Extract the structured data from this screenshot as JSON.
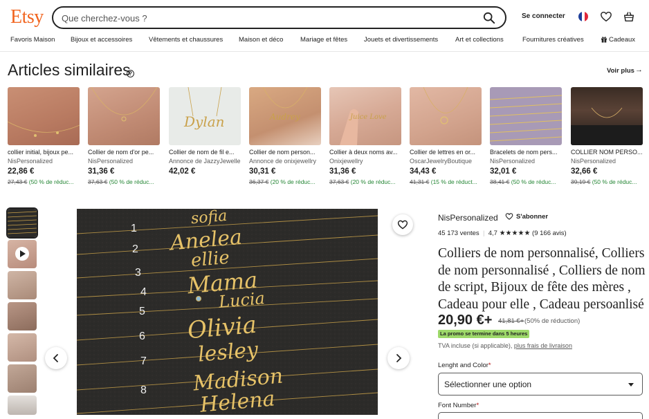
{
  "header": {
    "logo": "Etsy",
    "search_placeholder": "Que cherchez-vous ?",
    "signin": "Se connecter",
    "icons": [
      "search-icon",
      "flag-fr-icon",
      "heart-icon",
      "basket-icon"
    ]
  },
  "categories": [
    "Favoris Maison",
    "Bijoux et accessoires",
    "Vêtements et chaussures",
    "Maison et déco",
    "Mariage et fêtes",
    "Jouets et divertissements",
    "Art et collections",
    "Fournitures créatives",
    "Cadeaux"
  ],
  "similar": {
    "title": "Articles similaires",
    "see_more": "Voir plus",
    "items": [
      {
        "title": "collier initial, bijoux pe...",
        "shop": "NisPersonalized",
        "price": "22,86 €",
        "old": "27,43 €",
        "discount": "(50 % de réduc...",
        "caption": ""
      },
      {
        "title": "Collier de nom d'or pe...",
        "shop": "NisPersonalized",
        "price": "31,36 €",
        "old": "37,63 €",
        "discount": "(50 % de réduc...",
        "caption": ""
      },
      {
        "title": "Collier de nom de fil e...",
        "shop": "Annonce de JazzyJewelle",
        "price": "42,02 €",
        "old": "",
        "discount": "",
        "caption": "Dylan"
      },
      {
        "title": "Collier de nom person...",
        "shop": "Annonce de onixjewellry",
        "price": "30,31 €",
        "old": "36,37 €",
        "discount": "(20 % de réduc...",
        "caption": "Audrey"
      },
      {
        "title": "Collier à deux noms av...",
        "shop": "Onixjewellry",
        "price": "31,36 €",
        "old": "37,63 €",
        "discount": "(20 % de réduc...",
        "caption": "Juice Love"
      },
      {
        "title": "Collier de lettres en or...",
        "shop": "OscarJewelryBoutique",
        "price": "34,43 €",
        "old": "41,31 €",
        "discount": "(15 % de réduct...",
        "caption": ""
      },
      {
        "title": "Bracelets de nom pers...",
        "shop": "NisPersonalized",
        "price": "32,01 €",
        "old": "38,41 €",
        "discount": "(50 % de réduc...",
        "caption": ""
      },
      {
        "title": "COLLIER NOM PERSO...",
        "shop": "NisPersonalized",
        "price": "32,66 €",
        "old": "39,19 €",
        "discount": "(50 % de réduc...",
        "caption": ""
      }
    ]
  },
  "gallery": {
    "thumbs": [
      "thumb-1",
      "thumb-video",
      "thumb-3",
      "thumb-4",
      "thumb-5",
      "thumb-6",
      "thumb-7"
    ],
    "names": [
      {
        "num": "1",
        "name": "sofia"
      },
      {
        "num": "2",
        "name": "Anelea"
      },
      {
        "num": "3",
        "name": "ellie"
      },
      {
        "num": "",
        "name": "Mama"
      },
      {
        "num": "4",
        "name": ""
      },
      {
        "num": "5",
        "name": "Lucia"
      },
      {
        "num": "6",
        "name": "Olivia"
      },
      {
        "num": "7",
        "name": "lesley"
      },
      {
        "num": "",
        "name": "Madison"
      },
      {
        "num": "8",
        "name": "Helena"
      }
    ]
  },
  "product": {
    "shop": "NisPersonalized",
    "follow": "S'abonner",
    "sales": "45 173 ventes",
    "rating": "4,7",
    "stars": "★★★★★",
    "reviews": "(9 166 avis)",
    "title": "Colliers de nom personnalisé, Colliers de nom personnalisé , Colliers de nom de script, Bijoux de fête des mères , Cadeau pour elle , Cadeau persoanlisé",
    "price": "20,90 €+",
    "old_price": "41,81 €+",
    "discount": "(50% de réduction)",
    "promo": "La promo se termine dans 5 heures",
    "tva": "TVA incluse (si applicable),",
    "shipping_link": "plus frais de livraison",
    "option1_label": "Lenght and Color",
    "option1_value": "Sélectionner une option",
    "option2_label": "Font Number",
    "required": "*"
  }
}
